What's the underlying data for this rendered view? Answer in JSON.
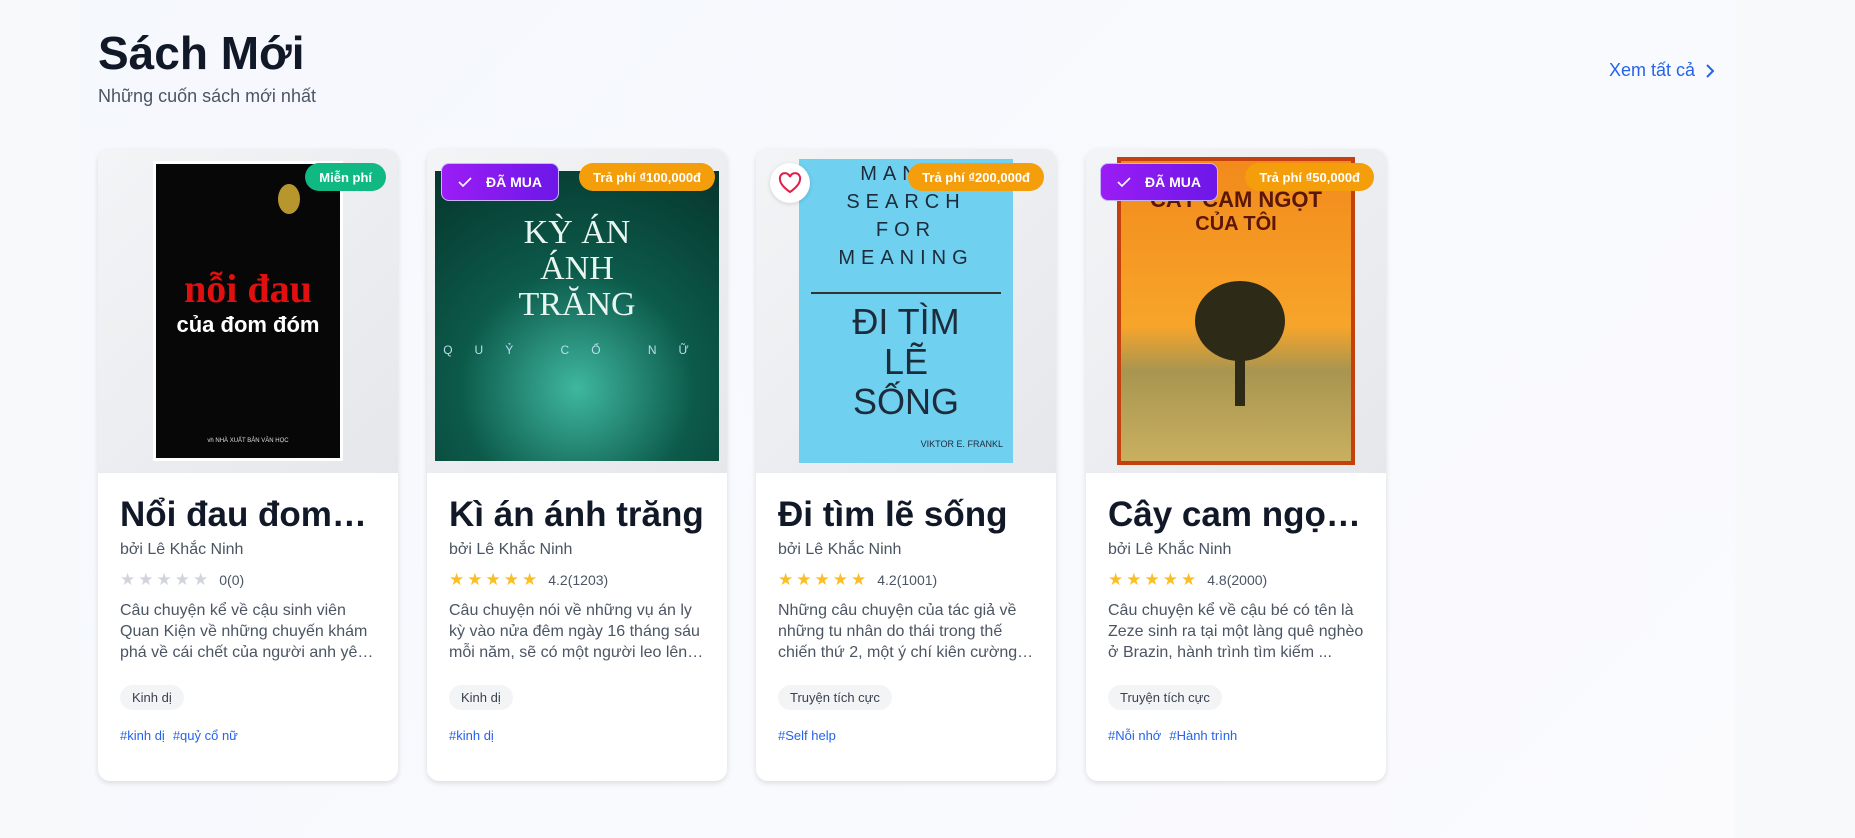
{
  "header": {
    "title": "Sách Mới",
    "subtitle": "Những cuốn sách mới nhất",
    "see_all": "Xem tất cả"
  },
  "colors": {
    "accent": "#2563eb",
    "free": "#10b981",
    "paid": "#f59e0b",
    "bought": "#7c1ff0",
    "star": "#fbbf24"
  },
  "books": [
    {
      "title": "Nỗi đau đom đóm",
      "display_title": "Nổi đau đom…",
      "author": "bởi Lê Khắc Ninh",
      "rating_text": "0(0)",
      "rating": 0,
      "desc": "Câu chuyện kể về cậu sinh viên Quan Kiện về những chuyến khám phá về cái chết của người anh yê…",
      "genre": "Kinh dị",
      "tags": [
        "#kinh dị",
        "#quỷ cổ nữ"
      ],
      "price_badge": "Miễn phí",
      "bought": false,
      "favorite": false,
      "cover_text": {
        "main": "nỗi đau",
        "sub": "của đom đóm",
        "publisher": "vh NHÀ XUẤT BẢN VĂN HỌC"
      }
    },
    {
      "title": "Kì án ánh trăng",
      "display_title": "Kì án ánh trăng",
      "author": "bởi Lê Khắc Ninh",
      "rating_text": "4.2(1203)",
      "rating": 4.2,
      "desc": "Câu chuyện nói về những vụ án ly kỳ vào nửa đêm ngày 16 tháng sáu mỗi năm, sẽ có một người leo lên…",
      "genre": "Kinh dị",
      "tags": [
        "#kinh dị"
      ],
      "price_badge": "Trả phí ₫100,000đ",
      "bought": true,
      "bought_label": "ĐÃ MUA",
      "favorite": false,
      "cover_text": {
        "main": "KỲ ÁN ÁNH TRĂNG",
        "sub": "QUỶ CỔ NỮ"
      }
    },
    {
      "title": "Đi tìm lẽ sống",
      "display_title": "Đi tìm lẽ sống",
      "author": "bởi Lê Khắc Ninh",
      "rating_text": "4.2(1001)",
      "rating": 4.2,
      "desc": "Những câu chuyện của tác giả về những tu nhân do thái trong thế chiến thứ 2, một ý chí kiên cường…",
      "genre": "Truyện tích cực",
      "tags": [
        "#Self help"
      ],
      "price_badge": "Trả phí ₫200,000đ",
      "bought": false,
      "favorite": false,
      "cover_text": {
        "main": "MAN'S SEARCH FOR MEANING",
        "sub": "ĐI TÌM LẼ SỐNG",
        "author": "VIKTOR E. FRANKL"
      }
    },
    {
      "title": "Cây cam ngọt của tôi",
      "display_title": "Cây cam ngọt…",
      "author": "bởi Lê Khắc Ninh",
      "rating_text": "4.8(2000)",
      "rating": 4.8,
      "desc": "Câu chuyện kể về cậu bé có tên là Zeze sinh ra tại một làng quê nghèo ở Brazin, hành trình tìm kiếm ...",
      "genre": "Truyện tích cực",
      "tags": [
        "#Nỗi nhớ",
        "#Hành trình"
      ],
      "price_badge": "Trả phí ₫50,000đ",
      "bought": true,
      "bought_label": "ĐÃ MUA",
      "favorite": false,
      "cover_text": {
        "main": "CÂY CAM NGỌT",
        "sub": "CỦA TÔI"
      }
    }
  ]
}
